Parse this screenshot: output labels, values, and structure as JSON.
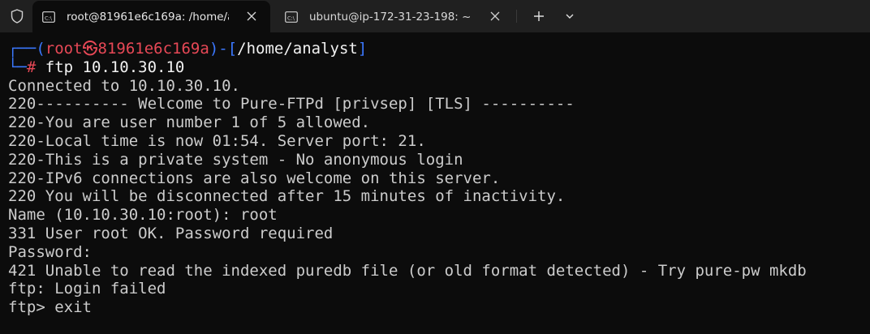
{
  "tabs": [
    {
      "title": "root@81961e6c169a: /home/a",
      "icon": "terminal-icon",
      "active": true
    },
    {
      "title": "ubuntu@ip-172-31-23-198: ~",
      "icon": "terminal-icon",
      "active": false
    }
  ],
  "prompt": {
    "corner_top": "┌──(",
    "user": "root",
    "at_symbol": "㉿",
    "host": "81961e6c169a",
    "mid": ")-[",
    "path": "/home/analyst",
    "end": "]",
    "corner_bottom": "└─",
    "hash": "#",
    "command": " ftp 10.10.30.10"
  },
  "output_lines": [
    "Connected to 10.10.30.10.",
    "220---------- Welcome to Pure-FTPd [privsep] [TLS] ----------",
    "220-You are user number 1 of 5 allowed.",
    "220-Local time is now 01:54. Server port: 21.",
    "220-This is a private system - No anonymous login",
    "220-IPv6 connections are also welcome on this server.",
    "220 You will be disconnected after 15 minutes of inactivity.",
    "Name (10.10.30.10:root): root",
    "331 User root OK. Password required",
    "Password:",
    "421 Unable to read the indexed puredb file (or old format detected) - Try pure-pw mkdb",
    "ftp: Login failed",
    "ftp> exit"
  ],
  "colors": {
    "background": "#0c0c0c",
    "tabbar": "#202020",
    "text": "#cccccc",
    "prompt_blue": "#3b78ff",
    "prompt_red": "#e74856"
  }
}
